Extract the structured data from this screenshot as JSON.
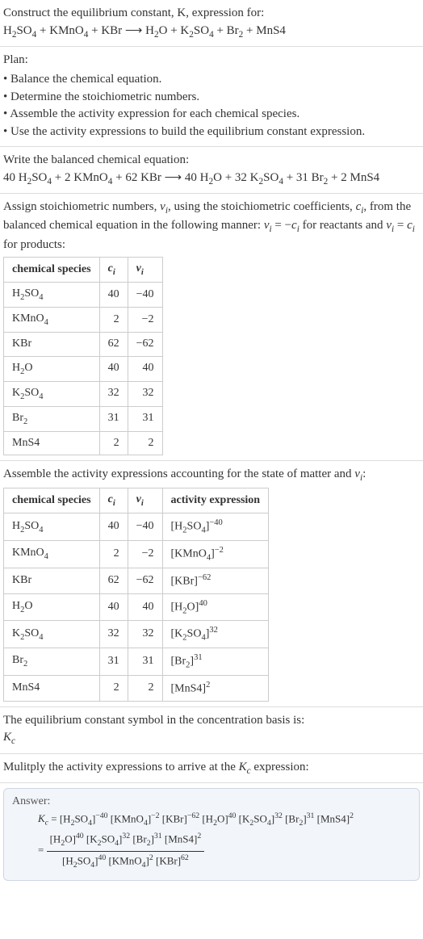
{
  "intro": {
    "prompt": "Construct the equilibrium constant, K, expression for:",
    "equation_html": "H<sub>2</sub>SO<sub>4</sub> + KMnO<sub>4</sub> + KBr ⟶ H<sub>2</sub>O + K<sub>2</sub>SO<sub>4</sub> + Br<sub>2</sub> + MnS4"
  },
  "plan": {
    "heading": "Plan:",
    "items": [
      "Balance the chemical equation.",
      "Determine the stoichiometric numbers.",
      "Assemble the activity expression for each chemical species.",
      "Use the activity expressions to build the equilibrium constant expression."
    ]
  },
  "balanced": {
    "heading": "Write the balanced chemical equation:",
    "equation_html": "40 H<sub>2</sub>SO<sub>4</sub> + 2 KMnO<sub>4</sub> + 62 KBr ⟶ 40 H<sub>2</sub>O + 32 K<sub>2</sub>SO<sub>4</sub> + 31 Br<sub>2</sub> + 2 MnS4"
  },
  "stoich": {
    "heading_html": "Assign stoichiometric numbers, <span class=\"italic\">ν<sub>i</sub></span>, using the stoichiometric coefficients, <span class=\"italic\">c<sub>i</sub></span>, from the balanced chemical equation in the following manner: <span class=\"italic\">ν<sub>i</sub></span> = −<span class=\"italic\">c<sub>i</sub></span> for reactants and <span class=\"italic\">ν<sub>i</sub></span> = <span class=\"italic\">c<sub>i</sub></span> for products:",
    "cols": {
      "species": "chemical species",
      "ci_html": "<span class=\"italic\">c<sub>i</sub></span>",
      "vi_html": "<span class=\"italic\">ν<sub>i</sub></span>"
    },
    "rows": [
      {
        "species_html": "H<sub>2</sub>SO<sub>4</sub>",
        "ci": "40",
        "vi": "−40"
      },
      {
        "species_html": "KMnO<sub>4</sub>",
        "ci": "2",
        "vi": "−2"
      },
      {
        "species_html": "KBr",
        "ci": "62",
        "vi": "−62"
      },
      {
        "species_html": "H<sub>2</sub>O",
        "ci": "40",
        "vi": "40"
      },
      {
        "species_html": "K<sub>2</sub>SO<sub>4</sub>",
        "ci": "32",
        "vi": "32"
      },
      {
        "species_html": "Br<sub>2</sub>",
        "ci": "31",
        "vi": "31"
      },
      {
        "species_html": "MnS4",
        "ci": "2",
        "vi": "2"
      }
    ]
  },
  "activity": {
    "heading_html": "Assemble the activity expressions accounting for the state of matter and <span class=\"italic\">ν<sub>i</sub></span>:",
    "cols": {
      "species": "chemical species",
      "ci_html": "<span class=\"italic\">c<sub>i</sub></span>",
      "vi_html": "<span class=\"italic\">ν<sub>i</sub></span>",
      "expr": "activity expression"
    },
    "rows": [
      {
        "species_html": "H<sub>2</sub>SO<sub>4</sub>",
        "ci": "40",
        "vi": "−40",
        "expr_html": "[H<sub>2</sub>SO<sub>4</sub>]<sup>−40</sup>"
      },
      {
        "species_html": "KMnO<sub>4</sub>",
        "ci": "2",
        "vi": "−2",
        "expr_html": "[KMnO<sub>4</sub>]<sup>−2</sup>"
      },
      {
        "species_html": "KBr",
        "ci": "62",
        "vi": "−62",
        "expr_html": "[KBr]<sup>−62</sup>"
      },
      {
        "species_html": "H<sub>2</sub>O",
        "ci": "40",
        "vi": "40",
        "expr_html": "[H<sub>2</sub>O]<sup>40</sup>"
      },
      {
        "species_html": "K<sub>2</sub>SO<sub>4</sub>",
        "ci": "32",
        "vi": "32",
        "expr_html": "[K<sub>2</sub>SO<sub>4</sub>]<sup>32</sup>"
      },
      {
        "species_html": "Br<sub>2</sub>",
        "ci": "31",
        "vi": "31",
        "expr_html": "[Br<sub>2</sub>]<sup>31</sup>"
      },
      {
        "species_html": "MnS4",
        "ci": "2",
        "vi": "2",
        "expr_html": "[MnS4]<sup>2</sup>"
      }
    ]
  },
  "kc_symbol": {
    "heading": "The equilibrium constant symbol in the concentration basis is:",
    "symbol_html": "<span class=\"italic\">K<sub>c</sub></span>"
  },
  "multiply": {
    "heading_html": "Mulitply the activity expressions to arrive at the <span class=\"italic\">K<sub>c</sub></span> expression:"
  },
  "answer": {
    "label": "Answer:",
    "line1_html": "<span class=\"italic\">K<sub>c</sub></span> = [H<sub>2</sub>SO<sub>4</sub>]<sup>−40</sup> [KMnO<sub>4</sub>]<sup>−2</sup> [KBr]<sup>−62</sup> [H<sub>2</sub>O]<sup>40</sup> [K<sub>2</sub>SO<sub>4</sub>]<sup>32</sup> [Br<sub>2</sub>]<sup>31</sup> [MnS4]<sup>2</sup>",
    "frac_num_html": "[H<sub>2</sub>O]<sup>40</sup> [K<sub>2</sub>SO<sub>4</sub>]<sup>32</sup> [Br<sub>2</sub>]<sup>31</sup> [MnS4]<sup>2</sup>",
    "frac_den_html": "[H<sub>2</sub>SO<sub>4</sub>]<sup>40</sup> [KMnO<sub>4</sub>]<sup>2</sup> [KBr]<sup>62</sup>"
  }
}
